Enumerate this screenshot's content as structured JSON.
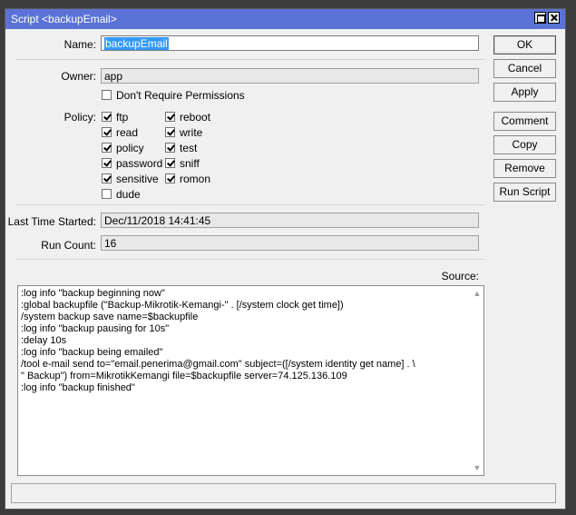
{
  "window": {
    "title": "Script <backupEmail>"
  },
  "form": {
    "name_label": "Name:",
    "name_value": "backupEmail",
    "owner_label": "Owner:",
    "owner_value": "app",
    "dont_require_permissions_label": "Don't Require Permissions",
    "dont_require_permissions_checked": false,
    "policy_label": "Policy:",
    "policies": [
      {
        "label": "ftp",
        "checked": true
      },
      {
        "label": "reboot",
        "checked": true
      },
      {
        "label": "read",
        "checked": true
      },
      {
        "label": "write",
        "checked": true
      },
      {
        "label": "policy",
        "checked": true
      },
      {
        "label": "test",
        "checked": true
      },
      {
        "label": "password",
        "checked": true
      },
      {
        "label": "sniff",
        "checked": true
      },
      {
        "label": "sensitive",
        "checked": true
      },
      {
        "label": "romon",
        "checked": true
      },
      {
        "label": "dude",
        "checked": false
      }
    ],
    "last_time_started_label": "Last Time Started:",
    "last_time_started_value": "Dec/11/2018 14:41:45",
    "run_count_label": "Run Count:",
    "run_count_value": "16",
    "source_label": "Source:",
    "source_text": ":log info \"backup beginning now\"\n:global backupfile (\"Backup-Mikrotik-Kemangi-\" . [/system clock get time])\n/system backup save name=$backupfile\n:log info \"backup pausing for 10s\"\n:delay 10s\n:log info \"backup being emailed\"\n/tool e-mail send to=\"email.penerima@gmail.com\" subject=([/system identity get name] . \\\n\" Backup\") from=MikrotikKemangi file=$backupfile server=74.125.136.109\n:log info \"backup finished\""
  },
  "buttons": {
    "ok": "OK",
    "cancel": "Cancel",
    "apply": "Apply",
    "comment": "Comment",
    "copy": "Copy",
    "remove": "Remove",
    "run_script": "Run Script"
  }
}
